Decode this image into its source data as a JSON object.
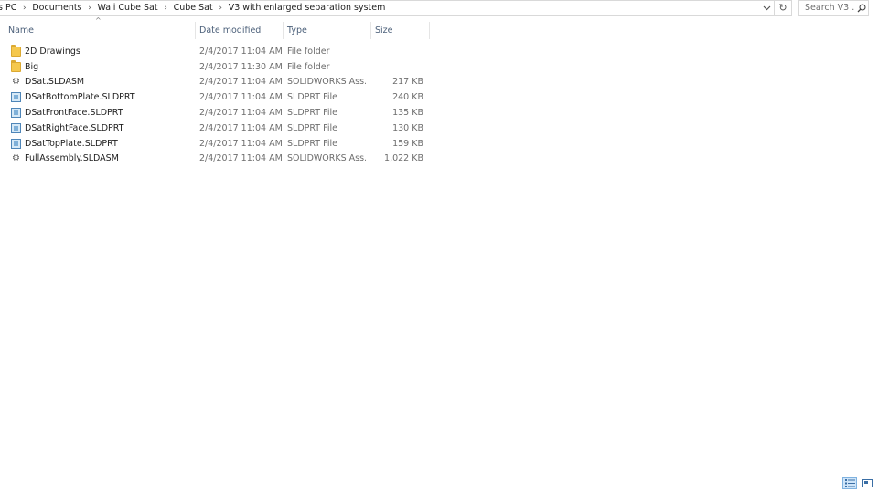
{
  "address": {
    "crumbs": [
      "s PC",
      "Documents",
      "Wali Cube Sat",
      "Cube Sat",
      "V3 with enlarged separation system"
    ]
  },
  "search": {
    "placeholder": "Search V3 ..."
  },
  "columns": {
    "name": "Name",
    "date": "Date modified",
    "type": "Type",
    "size": "Size"
  },
  "files": [
    {
      "name": "2D Drawings",
      "date": "2/4/2017 11:04 AM",
      "type": "File folder",
      "size": "",
      "icon": "folder-icon"
    },
    {
      "name": "Big",
      "date": "2/4/2017 11:30 AM",
      "type": "File folder",
      "size": "",
      "icon": "folder-icon"
    },
    {
      "name": "DSat.SLDASM",
      "date": "2/4/2017 11:04 AM",
      "type": "SOLIDWORKS Ass...",
      "size": "217 KB",
      "icon": "assembly-icon"
    },
    {
      "name": "DSatBottomPlate.SLDPRT",
      "date": "2/4/2017 11:04 AM",
      "type": "SLDPRT File",
      "size": "240 KB",
      "icon": "part-icon"
    },
    {
      "name": "DSatFrontFace.SLDPRT",
      "date": "2/4/2017 11:04 AM",
      "type": "SLDPRT File",
      "size": "135 KB",
      "icon": "part-icon"
    },
    {
      "name": "DSatRightFace.SLDPRT",
      "date": "2/4/2017 11:04 AM",
      "type": "SLDPRT File",
      "size": "130 KB",
      "icon": "part-icon"
    },
    {
      "name": "DSatTopPlate.SLDPRT",
      "date": "2/4/2017 11:04 AM",
      "type": "SLDPRT File",
      "size": "159 KB",
      "icon": "part-icon"
    },
    {
      "name": "FullAssembly.SLDASM",
      "date": "2/4/2017 11:04 AM",
      "type": "SOLIDWORKS Ass...",
      "size": "1,022 KB",
      "icon": "assembly-icon"
    }
  ],
  "view": {
    "active": "details"
  }
}
